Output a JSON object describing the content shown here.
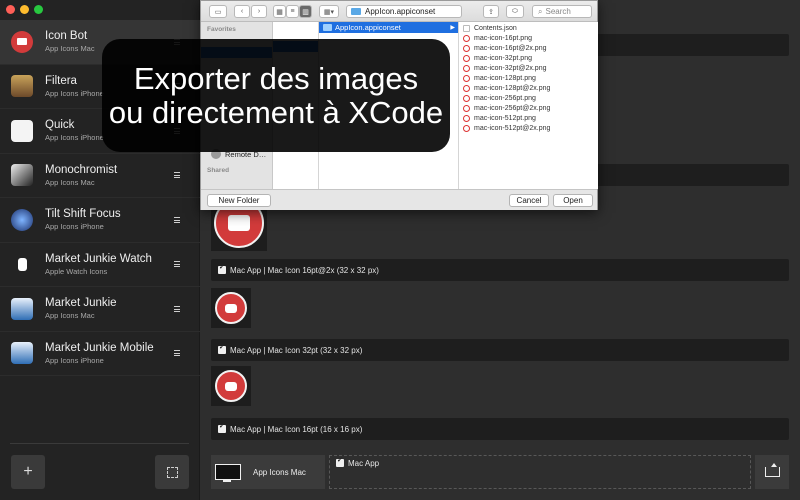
{
  "sidebar": {
    "projects": [
      {
        "name": "Icon Bot",
        "sub": "App Icons Mac",
        "icon": "icon-bot-app-icon",
        "selected": true
      },
      {
        "name": "Filtera",
        "sub": "App Icons iPhone",
        "icon": "filtera-app-icon"
      },
      {
        "name": "Quick",
        "sub": "App Icons iPhone",
        "icon": "quick-contact-app-icon"
      },
      {
        "name": "Monochromist",
        "sub": "App Icons Mac",
        "icon": "monochromist-app-icon"
      },
      {
        "name": "Tilt Shift Focus",
        "sub": "App Icons iPhone",
        "icon": "tilt-shift-app-icon"
      },
      {
        "name": "Market Junkie Watch",
        "sub": "Apple Watch Icons",
        "icon": "watch-app-icon"
      },
      {
        "name": "Market Junkie",
        "sub": "App Icons Mac",
        "icon": "market-junkie-app-icon"
      },
      {
        "name": "Market Junkie Mobile",
        "sub": "App Icons iPhone",
        "icon": "market-junkie-mobile-app-icon"
      }
    ],
    "add_label": "+"
  },
  "main": {
    "rows": [
      {
        "label": "Mac App | Mac Icon 16pt@2x (32 x 32 px)"
      },
      {
        "label": "Mac App | Mac Icon 32pt (32 x 32 px)"
      },
      {
        "label": "Mac App | Mac Icon 16pt (16 x 16 px)"
      }
    ],
    "target_label": "App Icons Mac",
    "drop_item": "Mac App"
  },
  "dialog": {
    "path": "AppIcon.appiconset",
    "search_placeholder": "Search",
    "favorites_header": "Favorites",
    "shared_header": "Shared",
    "remote_disk": "Remote D…",
    "selected_folder": "AppIcon.appiconset",
    "files": [
      "Contents.json",
      "mac-icon-16pt.png",
      "mac-icon-16pt@2x.png",
      "mac-icon-32pt.png",
      "mac-icon-32pt@2x.png",
      "mac-icon-128pt.png",
      "mac-icon-128pt@2x.png",
      "mac-icon-256pt.png",
      "mac-icon-256pt@2x.png",
      "mac-icon-512pt.png",
      "mac-icon-512pt@2x.png"
    ],
    "new_folder": "New Folder",
    "cancel": "Cancel",
    "open": "Open"
  },
  "overlay": {
    "line1": "Exporter des images",
    "line2": "ou directement à XCode"
  },
  "colors": {
    "accent_blue": "#2f7de1",
    "icon_red": "#d23b3b",
    "sidebar_bg": "#232323",
    "main_bg": "#2e2e2e"
  }
}
